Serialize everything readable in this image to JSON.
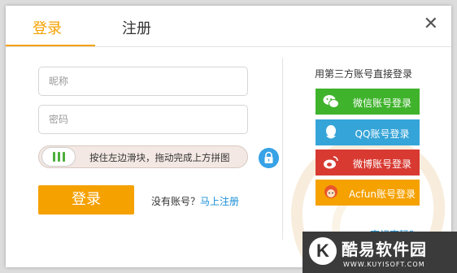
{
  "tabs": {
    "login": "登录",
    "register": "注册"
  },
  "close_icon": "close-icon",
  "nickname": {
    "placeholder": "昵称",
    "value": ""
  },
  "password": {
    "placeholder": "密码",
    "value": ""
  },
  "slider": {
    "text": "按住左边滑块，拖动完成上方拼图",
    "handle_icon": "grip-icon"
  },
  "lock_icon": "lock-icon",
  "login_button": "登录",
  "no_account": {
    "text": "没有账号？",
    "link": "马上注册"
  },
  "third_party": {
    "title": "用第三方账号直接登录",
    "buttons": [
      {
        "label": "微信账号登录",
        "icon": "wechat-icon",
        "color": "#3fb32c"
      },
      {
        "label": "QQ账号登录",
        "icon": "qq-icon",
        "color": "#35a4d8"
      },
      {
        "label": "微博账号登录",
        "icon": "weibo-icon",
        "color": "#d83a32"
      },
      {
        "label": "Acfun账号登录",
        "icon": "acfun-icon",
        "color": "#f5a100"
      }
    ]
  },
  "forgot_password": "忘记密码？",
  "watermark": {
    "name": "酷易软件园",
    "url": "WWW.KUYISOFT.COM",
    "letter": "K"
  },
  "accent_color": "#f5a100",
  "link_color": "#1a8fd6"
}
